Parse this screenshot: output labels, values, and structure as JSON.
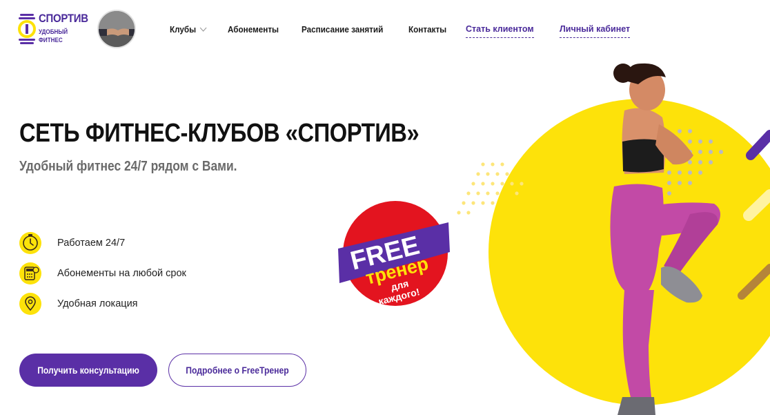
{
  "logo": {
    "title": "СПОРТИВ",
    "subtitle_line1": "УДОБНЫЙ",
    "subtitle_line2": "ФИТНЕС"
  },
  "nav": {
    "clubs": "Клубы",
    "subscriptions": "Абонементы",
    "schedule": "Расписание занятий",
    "contacts": "Контакты"
  },
  "top_links": {
    "become_client": "Стать клиентом",
    "account": "Личный кабинет"
  },
  "hero": {
    "title": "СЕТЬ ФИТНЕС-КЛУБОВ «СПОРТИВ»",
    "subtitle": "Удобный фитнес 24/7 рядом с Вами."
  },
  "features": [
    {
      "icon": "clock-icon",
      "text": "Работаем 24/7"
    },
    {
      "icon": "calculator-icon",
      "text": "Абонементы на любой срок"
    },
    {
      "icon": "location-pin-icon",
      "text": "Удобная локация"
    }
  ],
  "buttons": {
    "consult": "Получить консультацию",
    "more_free": "Подробнее о FreeТренер"
  },
  "badge": {
    "line1": "FREE",
    "line2": "тренер",
    "line3": "для",
    "line4": "каждого!"
  },
  "colors": {
    "brand_purple": "#5a2fa6",
    "accent_yellow": "#fde20a",
    "badge_red": "#e3141f",
    "legging_pink": "#c24aa6"
  }
}
